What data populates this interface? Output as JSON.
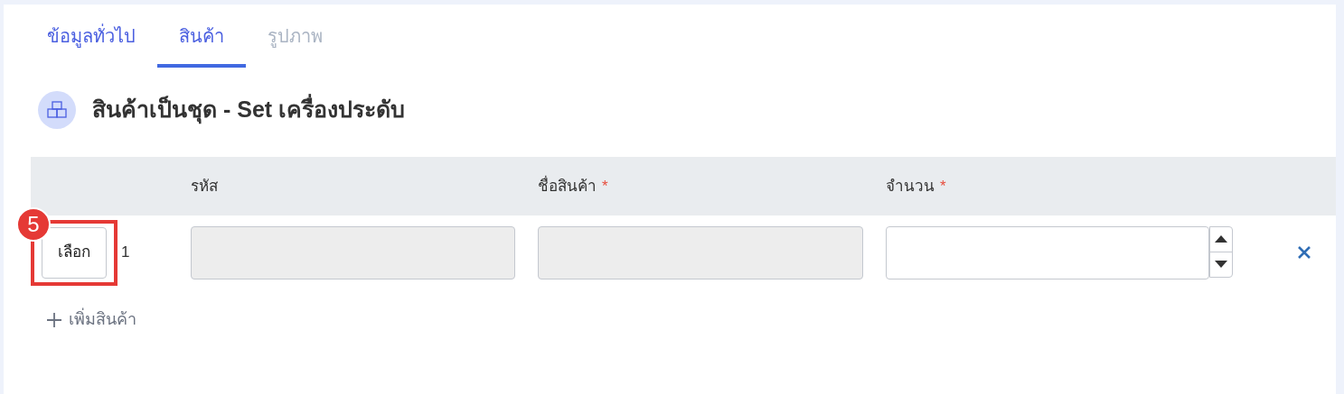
{
  "tabs": [
    {
      "label": "ข้อมูลทั่วไป",
      "selected": false,
      "disabled": false
    },
    {
      "label": "สินค้า",
      "selected": true,
      "disabled": false
    },
    {
      "label": "รูปภาพ",
      "selected": false,
      "disabled": true
    }
  ],
  "section": {
    "title": "สินค้าเป็นชุด - Set เครื่องประดับ"
  },
  "table": {
    "columns": [
      {
        "label": "รหัส"
      },
      {
        "label": "ชื่อสินค้า",
        "required_mark": "*"
      },
      {
        "label": "จำนวน",
        "required_mark": "*"
      }
    ],
    "rows": [
      {
        "select_button": "เลือก",
        "number": "1",
        "code": {
          "disabled": true
        },
        "name": {
          "disabled": true
        },
        "quantity": {
          "disabled": false
        }
      }
    ]
  },
  "add_button": "เพิ่มสินค้า",
  "annotation": {
    "number": "5"
  }
}
